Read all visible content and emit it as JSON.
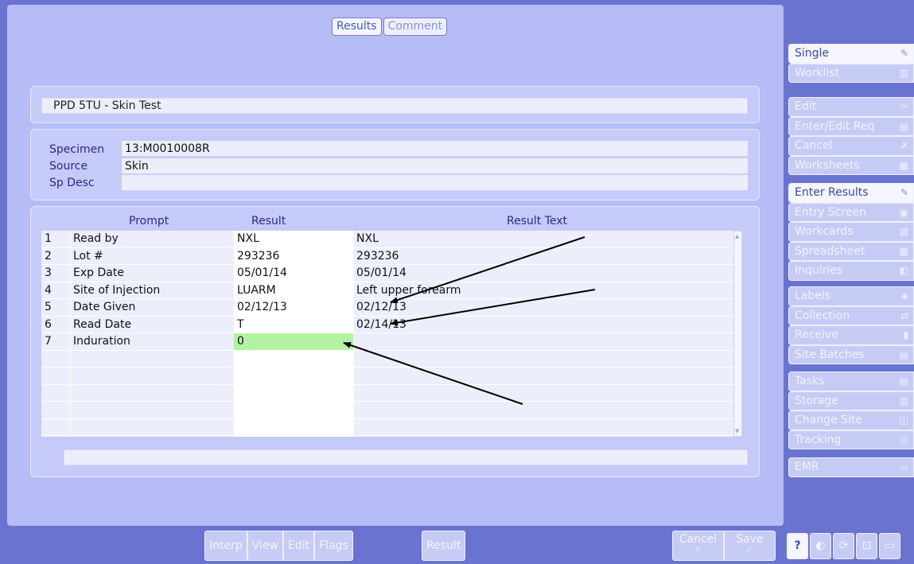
{
  "tabs": {
    "results": "Results",
    "comment": "Comment"
  },
  "test": {
    "name": "PPD 5TU - Skin Test"
  },
  "specimen": {
    "specimen_label": "Specimen",
    "specimen_value": "13:M0010008R",
    "source_label": "Source",
    "source_value": "Skin",
    "desc_label": "Sp Desc",
    "desc_value": ""
  },
  "table": {
    "headers": {
      "prompt": "Prompt",
      "result": "Result",
      "text": "Result Text"
    },
    "rows": [
      {
        "num": "1",
        "prompt": "Read by",
        "result": "NXL",
        "text": "NXL"
      },
      {
        "num": "2",
        "prompt": "Lot #",
        "result": "293236",
        "text": "293236"
      },
      {
        "num": "3",
        "prompt": "Exp Date",
        "result": "05/01/14",
        "text": "05/01/14"
      },
      {
        "num": "4",
        "prompt": "Site of Injection",
        "result": "LUARM",
        "text": "Left upper forearm"
      },
      {
        "num": "5",
        "prompt": "Date Given",
        "result": "02/12/13",
        "text": "02/12/13"
      },
      {
        "num": "6",
        "prompt": "Read Date",
        "result": "T",
        "text": "02/14/13"
      },
      {
        "num": "7",
        "prompt": "Induration",
        "result": "0",
        "text": ""
      }
    ]
  },
  "menu": {
    "g1": [
      {
        "label": "Single",
        "icon": "pencil-icon"
      },
      {
        "label": "Worklist",
        "icon": "barcode-icon"
      }
    ],
    "g2": [
      {
        "label": "Edit",
        "icon": "tools-icon"
      },
      {
        "label": "Enter/Edit Req",
        "icon": "form-icon"
      },
      {
        "label": "Cancel",
        "icon": "cancel-icon"
      },
      {
        "label": "Worksheets",
        "icon": "worksheet-icon"
      }
    ],
    "g3": [
      {
        "label": "Enter Results",
        "icon": "edit-results-icon"
      },
      {
        "label": "Entry Screen",
        "icon": "entry-icon"
      },
      {
        "label": "Workcards",
        "icon": "workcard-icon"
      },
      {
        "label": "Spreadsheet",
        "icon": "spreadsheet-icon"
      },
      {
        "label": "Inquiries",
        "icon": "inquiry-icon"
      }
    ],
    "g4": [
      {
        "label": "Labels",
        "icon": "label-icon"
      },
      {
        "label": "Collection",
        "icon": "collection-icon"
      },
      {
        "label": "Receive",
        "icon": "receive-icon"
      },
      {
        "label": "Site Batches",
        "icon": "batch-icon"
      }
    ],
    "g5": [
      {
        "label": "Tasks",
        "icon": "task-icon"
      },
      {
        "label": "Storage",
        "icon": "storage-icon"
      },
      {
        "label": "Change Site",
        "icon": "change-site-icon"
      },
      {
        "label": "Tracking",
        "icon": "tracking-icon"
      }
    ],
    "g6": [
      {
        "label": "EMR",
        "icon": "emr-icon"
      }
    ]
  },
  "bottom": {
    "interp": "Interp",
    "view": "View",
    "edit": "Edit",
    "flags": "Flags",
    "result": "Result",
    "cancel": "Cancel",
    "save": "Save",
    "cancel_glyph": "✕",
    "save_glyph": "✓",
    "help": "?"
  }
}
